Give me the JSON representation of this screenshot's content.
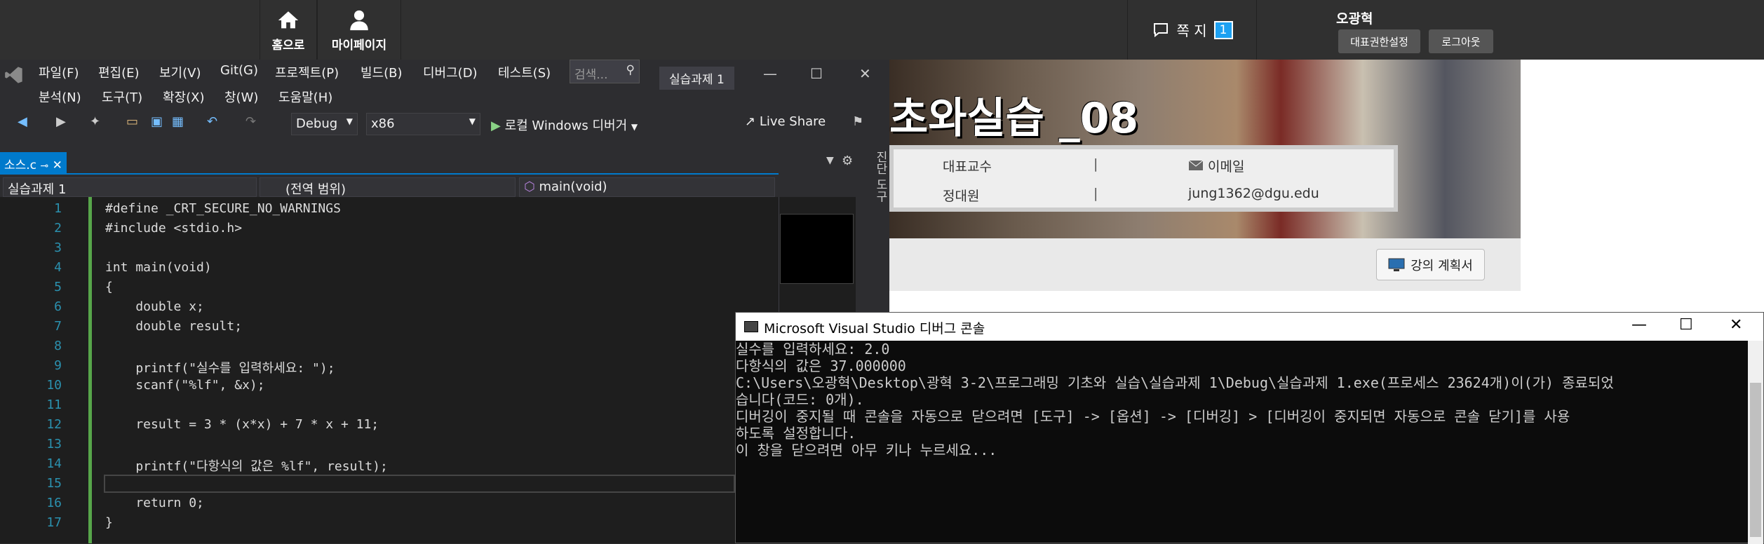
{
  "web": {
    "nav_home": "홈으로",
    "nav_mypage": "마이페이지",
    "messages_label": "쪽 지",
    "messages_count": "1",
    "user_name": "오광혁",
    "btn_permission": "대표권한설정",
    "btn_logout": "로그아웃",
    "course_title": "초와실습 _08",
    "prof_header_role": "대표교수",
    "prof_header_email": "이메일",
    "prof_name": "정대원",
    "prof_email": "jung1362@dgu.edu",
    "syllabus_btn": "강의 계획서",
    "sep": "|"
  },
  "vs": {
    "menu": [
      "파일(F)",
      "편집(E)",
      "보기(V)",
      "Git(G)",
      "프로젝트(P)",
      "빌드(B)",
      "디버그(D)",
      "테스트(S)"
    ],
    "menu2": [
      "분석(N)",
      "도구(T)",
      "확장(X)",
      "창(W)",
      "도움말(H)"
    ],
    "search_placeholder": "검색...",
    "solution_title": "실습과제 1",
    "config": "Debug",
    "platform": "x86",
    "run_label": "로컬 Windows 디버거",
    "live_share": "Live Share",
    "file_tab": "소스.c",
    "nav_project": "실습과제 1",
    "nav_scope": "(전역 범위)",
    "nav_func": "main(void)",
    "side_tools": "진단 도구",
    "line_numbers": [
      "1",
      "2",
      "3",
      "4",
      "5",
      "6",
      "7",
      "8",
      "9",
      "10",
      "11",
      "12",
      "13",
      "14",
      "15",
      "16",
      "17"
    ],
    "code_lines": [
      "#define _CRT_SECURE_NO_WARNINGS",
      "#include <stdio.h>",
      "",
      "int main(void)",
      "{",
      "    double x;",
      "    double result;",
      "",
      "    printf(\"실수를 입력하세요: \");",
      "    scanf(\"%lf\", &x);",
      "",
      "    result = 3 * (x*x) + 7 * x + 11;",
      "",
      "    printf(\"다항식의 값은 %lf\", result);",
      "",
      "    return 0;",
      "}"
    ]
  },
  "console": {
    "title": "Microsoft Visual Studio 디버그 콘솔",
    "lines": [
      "실수를 입력하세요: 2.0",
      "다항식의 값은 37.000000",
      "C:\\Users\\오광혁\\Desktop\\광혁 3-2\\프로그래밍 기초와 실습\\실습과제 1\\Debug\\실습과제 1.exe(프로세스 23624개)이(가) 종료되었",
      "습니다(코드: 0개).",
      "디버깅이 중지될 때 콘솔을 자동으로 닫으려면 [도구] -> [옵션] -> [디버깅] > [디버깅이 중지되면 자동으로 콘솔 닫기]를 사용",
      "하도록 설정합니다.",
      "이 창을 닫으려면 아무 키나 누르세요..."
    ]
  }
}
